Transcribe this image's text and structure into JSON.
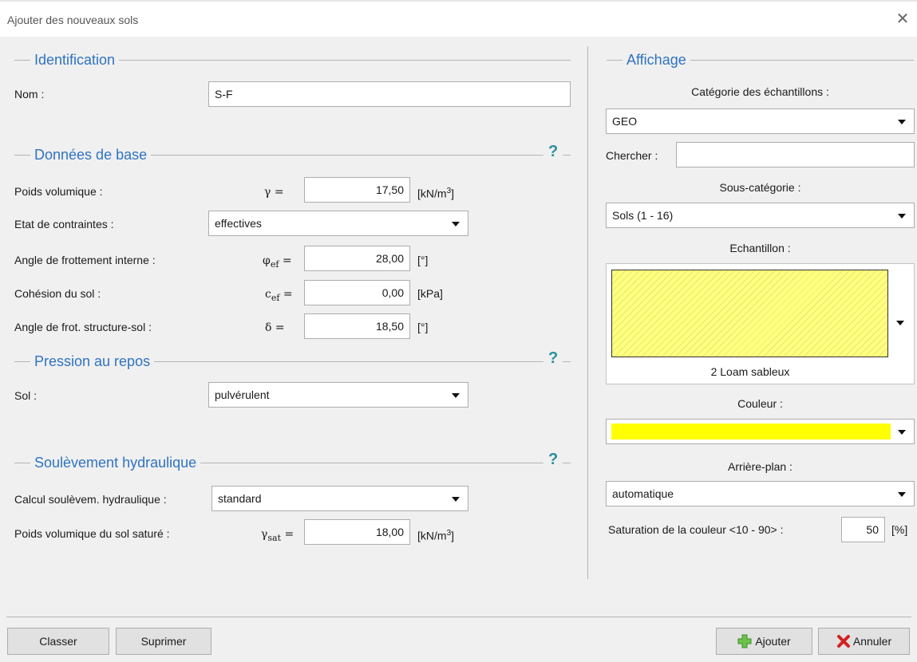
{
  "window": {
    "title": "Ajouter des nouveaux sols",
    "close_glyph": "✕"
  },
  "identification": {
    "heading": "Identification",
    "name_label": "Nom :",
    "name_value": "S-F"
  },
  "base_data": {
    "heading": "Données de base",
    "help_glyph": "?",
    "unit_weight": {
      "label": "Poids volumique :",
      "symbol": "γ =",
      "value": "17,50",
      "unit_main": "[kN/m",
      "unit_sup": "3",
      "unit_end": "]"
    },
    "stress_state": {
      "label": "Etat de contraintes :",
      "value": "effectives"
    },
    "friction_angle": {
      "label": "Angle de frottement interne :",
      "symbol": "φ",
      "symbol_sub": "ef",
      "symbol_end": " =",
      "value": "28,00",
      "unit": "[°]"
    },
    "cohesion": {
      "label": "Cohésion du sol :",
      "symbol": "c",
      "symbol_sub": "ef",
      "symbol_end": " =",
      "value": "0,00",
      "unit": "[kPa]"
    },
    "structure_friction": {
      "label": "Angle de frot. structure-sol :",
      "symbol": "δ =",
      "value": "18,50",
      "unit": "[°]"
    }
  },
  "rest_pressure": {
    "heading": "Pression au repos",
    "help_glyph": "?",
    "soil_label": "Sol :",
    "soil_value": "pulvérulent"
  },
  "hydraulic": {
    "heading": "Soulèvement hydraulique",
    "help_glyph": "?",
    "calc_label": "Calcul soulèvem. hydraulique :",
    "calc_value": "standard",
    "saturated": {
      "label": "Poids volumique du sol saturé :",
      "symbol": "γ",
      "symbol_sub": "sat",
      "symbol_end": " =",
      "value": "18,00",
      "unit_main": "[kN/m",
      "unit_sup": "3",
      "unit_end": "]"
    }
  },
  "display": {
    "heading": "Affichage",
    "category_label": "Catégorie des échantillons :",
    "category_value": "GEO",
    "search_label": "Chercher :",
    "search_value": "",
    "subcategory_label": "Sous-catégorie :",
    "subcategory_value": "Sols (1 - 16)",
    "sample_label": "Echantillon :",
    "sample_name": "2 Loam sableux",
    "sample_fill_color": "#ffff80",
    "color_label": "Couleur :",
    "color_value": "#ffff00",
    "background_label": "Arrière-plan :",
    "background_value": "automatique",
    "saturation_label": "Saturation de la couleur <10 - 90> :",
    "saturation_value": "50",
    "saturation_unit": "[%]"
  },
  "footer": {
    "classer_label": "Classer",
    "suprimer_label": "Suprimer",
    "ajouter_label": "Ajouter",
    "annuler_label": "Annuler"
  }
}
